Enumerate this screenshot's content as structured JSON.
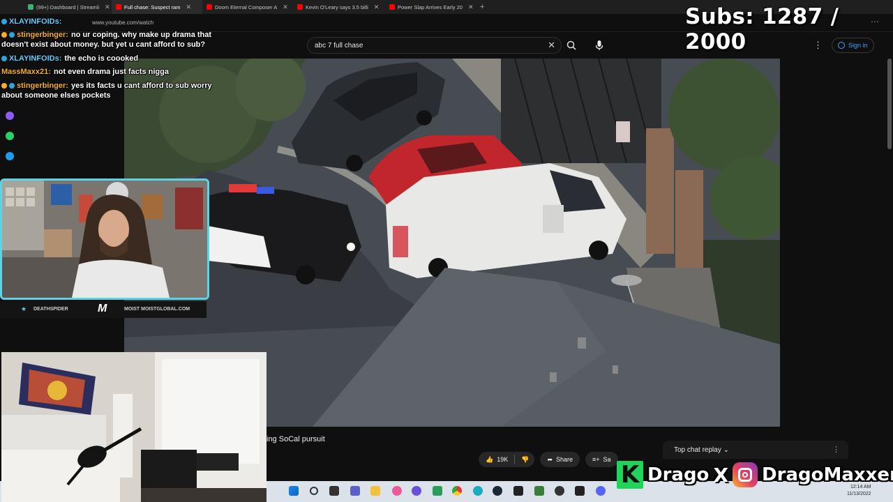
{
  "browser": {
    "tabs": [
      {
        "label": "(99+) Dashboard | Streamli",
        "color": "#3cb371",
        "active": false
      },
      {
        "label": "Full chase: Suspect ram",
        "color": "#ff0000",
        "active": true
      },
      {
        "label": "Doom Eternal Composer A",
        "color": "#ff0000",
        "active": false
      },
      {
        "label": "Kevin O'Leary says 3.5 billi",
        "color": "#ff0000",
        "active": false
      },
      {
        "label": "Power Slap Arrives Early 20",
        "color": "#ff0000",
        "active": false
      }
    ],
    "url": "www.youtube.com/watch"
  },
  "youtube": {
    "search_value": "abc 7 full chase",
    "clear_icon": "✕",
    "sign_in_label": "Sign in",
    "more_icon": "⋮",
    "video_title": "ing SoCal pursuit",
    "like_count": "19K",
    "share_label": "Share",
    "save_label": "Sa",
    "top_chat_replay_label": "Top chat replay ⌄",
    "chat_dots": "⋮"
  },
  "stream": {
    "subs_text": "Subs: 1287 / 2000",
    "chat": [
      {
        "name": "XLAYINFOIDs:",
        "name_color": "#5ed0ff",
        "badge_color": "#29a8e0",
        "text": ""
      },
      {
        "name": "stingerbinger:",
        "name_color": "#f7b022",
        "badge_color": "#29a8e0",
        "text": "no ur coping. why make up drama that doesn't exist about money. but yet u cant afford to sub?"
      },
      {
        "name": "XLAYINFOIDs:",
        "name_color": "#5ed0ff",
        "badge_color": "#29a8e0",
        "text": "the echo is coooked"
      },
      {
        "name": "MassMaxx21:",
        "name_color": "#f7b022",
        "badge_color": "",
        "text": "not even drama just facts nigga"
      },
      {
        "name": "stingerbinger:",
        "name_color": "#f7b022",
        "badge_color": "#29a8e0",
        "text": "yes its facts u cant afford to sub worry about someone elses pockets"
      }
    ],
    "webcam_banner_left": "DEATHSPIDER",
    "webcam_banner_logo": "M",
    "webcam_banner_right": "MOIST  MOISTGLOBAL.COM",
    "social_k": "K",
    "social_name1": "Drago",
    "social_x": "X",
    "social_name2": "DragoMaxxer"
  },
  "taskbar": {
    "time": "12:14 AM",
    "date": "11/13/2022"
  }
}
